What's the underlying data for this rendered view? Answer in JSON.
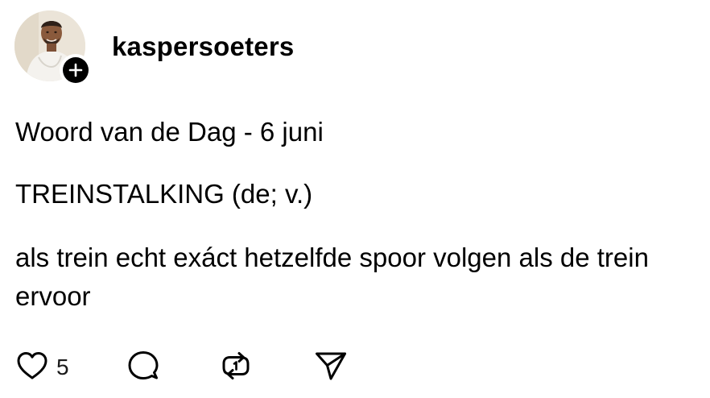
{
  "post": {
    "username": "kaspersoeters",
    "paragraphs": [
      "Woord van de Dag - 6 juni",
      "TREINSTALKING (de; v.)",
      "als trein echt exáct hetzelfde spoor volgen als de trein ervoor"
    ],
    "likes": "5"
  },
  "icons": {
    "like": "heart-icon",
    "reply": "speech-bubble-icon",
    "repost": "repost-arrows-icon",
    "share": "paper-plane-icon",
    "follow": "plus-icon"
  }
}
